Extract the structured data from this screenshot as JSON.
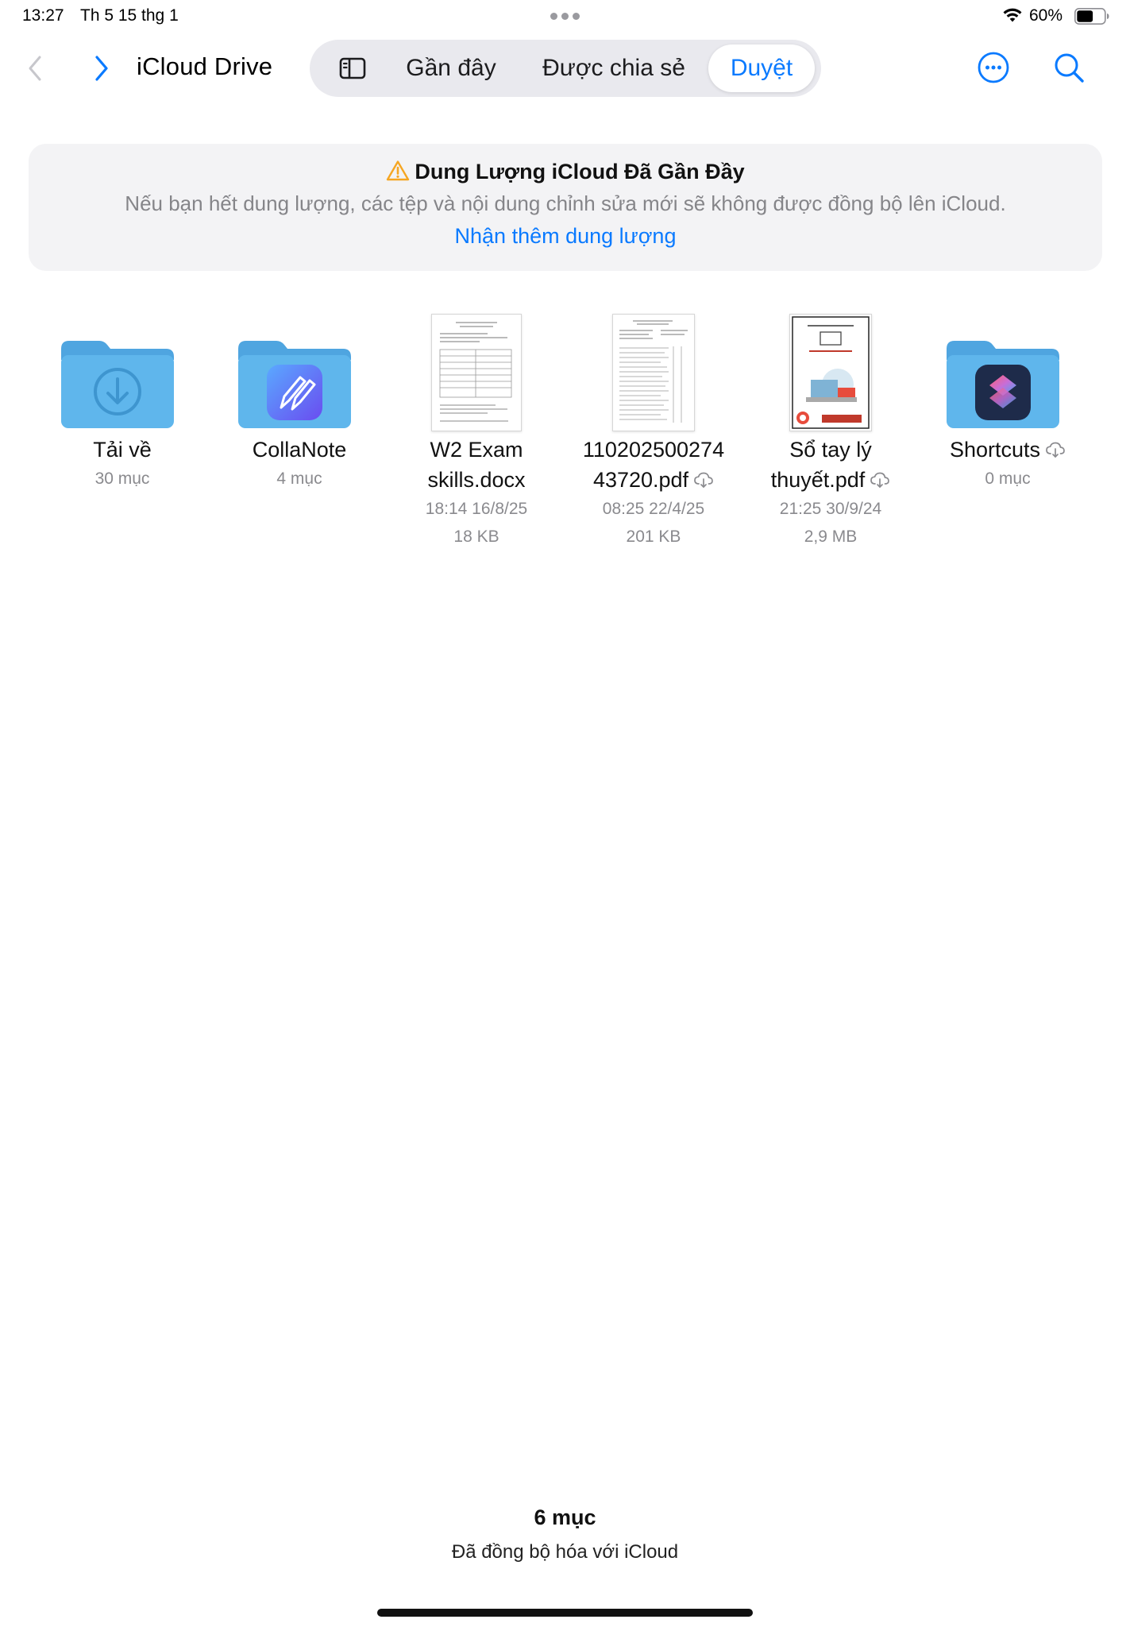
{
  "status_bar": {
    "time": "13:27",
    "date": "Th 5 15 thg 1",
    "battery_percent": "60%",
    "battery_level": 0.6
  },
  "toolbar": {
    "title": "iCloud Drive",
    "tabs": [
      {
        "label": "Gần đây",
        "selected": false
      },
      {
        "label": "Được chia sẻ",
        "selected": false
      },
      {
        "label": "Duyệt",
        "selected": true
      }
    ],
    "icons": [
      "chevron-left-icon",
      "chevron-right-icon",
      "sidebar-icon",
      "ellipsis-circle-icon",
      "magnifying-glass-icon"
    ]
  },
  "banner": {
    "title": "Dung Lượng iCloud Đã Gần Đầy",
    "message": "Nếu bạn hết dung lượng, các tệp và nội dung chỉnh sửa mới sẽ không được đồng bộ lên iCloud.",
    "link": "Nhận thêm dung lượng"
  },
  "items": [
    {
      "kind": "folder",
      "name_line1": "Tải về",
      "name_line2": "",
      "detail1": "30 mục",
      "detail2": "",
      "icon": "download-folder-icon"
    },
    {
      "kind": "folder",
      "name_line1": "CollaNote",
      "name_line2": "",
      "detail1": "4 mục",
      "detail2": "",
      "icon": "collanote-folder-icon"
    },
    {
      "kind": "file",
      "name_line1": "W2 Exam",
      "name_line2": "skills.docx",
      "detail1": "18:14 16/8/25",
      "detail2": "18 KB",
      "icon": "docx-thumbnail"
    },
    {
      "kind": "file",
      "name_line1": "110202500274",
      "name_line2": "43720.pdf",
      "detail1": "08:25 22/4/25",
      "detail2": "201 KB",
      "icon": "pdf-thumbnail",
      "cloud": true
    },
    {
      "kind": "file",
      "name_line1": "Sổ tay lý",
      "name_line2": "thuyết.pdf",
      "detail1": "21:25 30/9/24",
      "detail2": "2,9 MB",
      "icon": "pdf-cover-thumbnail",
      "cloud": true
    },
    {
      "kind": "folder",
      "name_line1": "Shortcuts",
      "name_line2": "",
      "detail1": "0 mục",
      "detail2": "",
      "icon": "shortcuts-folder-icon",
      "cloud": true
    }
  ],
  "footer": {
    "count": "6 mục",
    "sync_status": "Đã đồng bộ hóa với iCloud"
  },
  "colors": {
    "accent": "#0a7aff",
    "folder": "#5fb6ec",
    "warning": "#f5a623",
    "secondary_text": "#8a8a8e"
  }
}
